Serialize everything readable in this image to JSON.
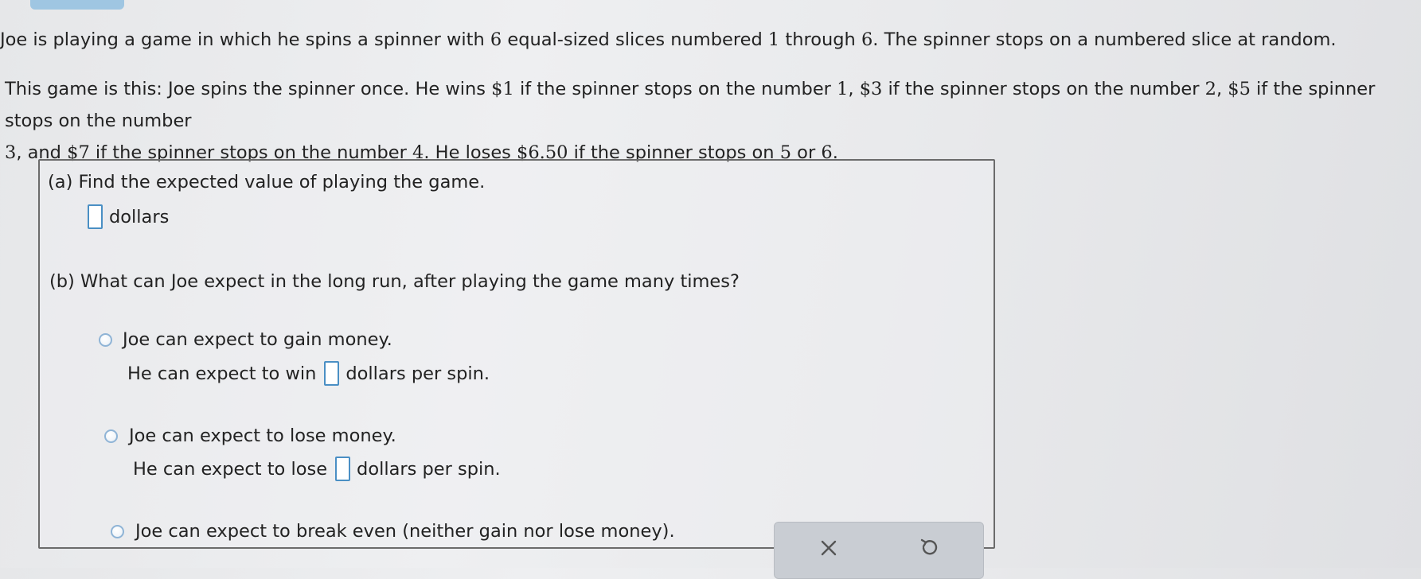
{
  "intro": {
    "p1_a": "Joe is playing a game in which he spins a spinner with ",
    "p1_n1": "6",
    "p1_b": " equal-sized slices numbered ",
    "p1_n2": "1",
    "p1_c": " through ",
    "p1_n3": "6",
    "p1_d": ". The spinner stops on a numbered slice at random.",
    "p2_a": "This game is this: Joe spins the spinner once. He wins ",
    "p2_v1": "$1",
    "p2_b": " if the spinner stops on the number ",
    "p2_n1": "1",
    "p2_c": ", ",
    "p2_v2": "$3",
    "p2_d": " if the spinner stops on the number ",
    "p2_n2": "2",
    "p2_e": ", ",
    "p2_v3": "$5",
    "p2_f": " if the spinner stops on the number ",
    "p2_n3": "3",
    "p2_g": ", and ",
    "p2_v4": "$7",
    "p2_h": " if the spinner stops on the number ",
    "p2_n4": "4",
    "p2_i": ". He loses ",
    "p2_v5": "$6.50",
    "p2_j": " if the spinner stops on ",
    "p2_n5": "5",
    "p2_k": " or ",
    "p2_n6": "6",
    "p2_l": "."
  },
  "part_a": {
    "question": "(a) Find the expected value of playing the game.",
    "unit": "dollars",
    "answer_value": ""
  },
  "part_b": {
    "question": "(b) What can Joe expect in the long run, after playing the game many times?",
    "options": [
      {
        "label": "Joe can expect to gain money.",
        "detail_before": "He can expect to win",
        "detail_after": "dollars per spin.",
        "selected": false
      },
      {
        "label": "Joe can expect to lose money.",
        "detail_before": "He can expect to lose",
        "detail_after": "dollars per spin.",
        "selected": false
      },
      {
        "label": "Joe can expect to break even (neither gain nor lose money).",
        "selected": false
      }
    ]
  },
  "toolbar": {
    "clear_icon": "x-icon",
    "undo_icon": "undo-icon"
  },
  "colors": {
    "input_border": "#4a8fc4",
    "radio_border": "#8fb4d6",
    "top_tab": "#9fc6e2",
    "toolbar_bg": "#c9cdd3"
  }
}
